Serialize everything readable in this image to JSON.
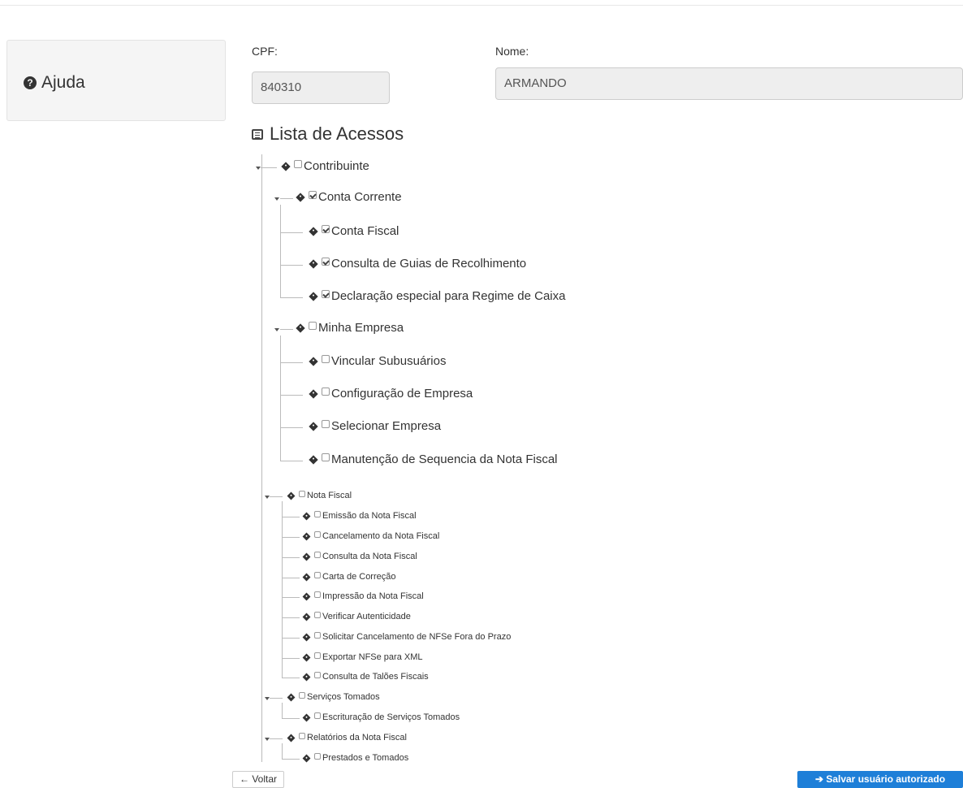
{
  "help": {
    "label": "Ajuda",
    "icon": "question-circle-icon"
  },
  "form": {
    "cpf_label": "CPF:",
    "cpf_value": "840310",
    "nome_label": "Nome:",
    "nome_value": "ARMANDO"
  },
  "lista_title": "Lista de Acessos",
  "tree": [
    {
      "label": "Contribuinte",
      "checked": false,
      "children": [
        {
          "label": "Conta Corrente",
          "checked": true,
          "children": [
            {
              "label": "Conta Fiscal",
              "checked": true
            },
            {
              "label": "Consulta de Guias de Recolhimento",
              "checked": true
            },
            {
              "label": "Declaração especial para Regime de Caixa",
              "checked": true
            }
          ]
        },
        {
          "label": "Minha Empresa",
          "checked": false,
          "children": [
            {
              "label": "Vincular Subusuários",
              "checked": false
            },
            {
              "label": "Configuração de Empresa",
              "checked": false
            },
            {
              "label": "Selecionar Empresa",
              "checked": false
            },
            {
              "label": "Manutenção de Sequencia da Nota Fiscal",
              "checked": false
            }
          ]
        },
        {
          "label": "Nota Fiscal",
          "checked": false,
          "children": [
            {
              "label": "Emissão da Nota Fiscal",
              "checked": false
            },
            {
              "label": "Cancelamento da Nota Fiscal",
              "checked": false
            },
            {
              "label": "Consulta da Nota Fiscal",
              "checked": false
            },
            {
              "label": "Carta de Correção",
              "checked": false
            },
            {
              "label": "Impressão da Nota Fiscal",
              "checked": false
            },
            {
              "label": "Verificar Autenticidade",
              "checked": false
            },
            {
              "label": "Solicitar Cancelamento de NFSe Fora do Prazo",
              "checked": false
            },
            {
              "label": "Exportar NFSe para XML",
              "checked": false
            },
            {
              "label": "Consulta de Talões Fiscais",
              "checked": false
            }
          ]
        },
        {
          "label": "Serviços Tomados",
          "checked": false,
          "children": [
            {
              "label": "Escrituração de Serviços Tomados",
              "checked": false
            }
          ]
        },
        {
          "label": "Relatórios da Nota Fiscal",
          "checked": false,
          "children": [
            {
              "label": "Prestados e Tomados",
              "checked": false
            }
          ]
        }
      ]
    }
  ],
  "buttons": {
    "back_label": "← Voltar",
    "save_label": "➔ Salvar usuário autorizado"
  },
  "colors": {
    "primary": "#1e7fd8",
    "input_bg": "#eeeeee"
  }
}
